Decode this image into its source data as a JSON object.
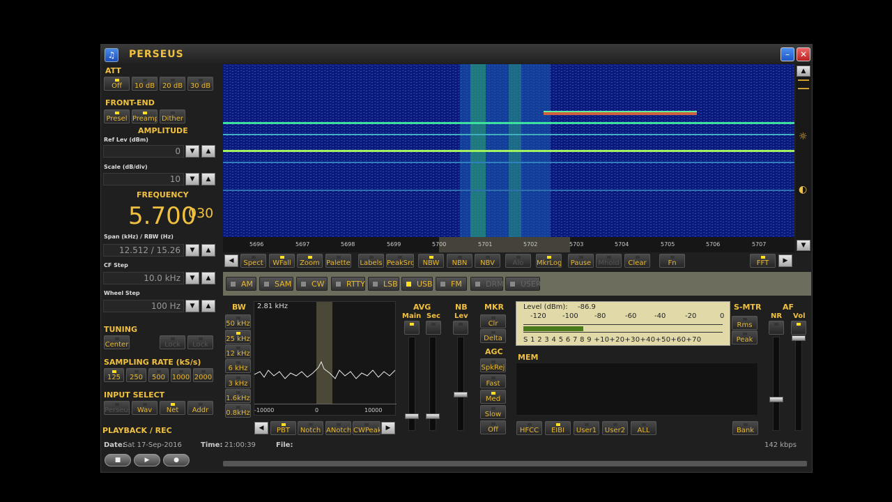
{
  "window": {
    "title": "PERSEUS",
    "min_icon": "minimize-icon",
    "close_icon": "close-icon"
  },
  "att": {
    "label": "ATT",
    "buttons": [
      {
        "label": "Off",
        "on": true
      },
      {
        "label": "10 dB",
        "on": false
      },
      {
        "label": "20 dB",
        "on": false
      },
      {
        "label": "30 dB",
        "on": false
      }
    ]
  },
  "frontend": {
    "label": "FRONT-END",
    "buttons": [
      {
        "label": "Presel",
        "on": true
      },
      {
        "label": "Preamp",
        "on": true
      },
      {
        "label": "Dither",
        "on": false
      }
    ]
  },
  "amplitude": {
    "label": "AMPLITUDE",
    "ref_label": "Ref Lev (dBm)",
    "ref_value": "0",
    "scale_label": "Scale (dB/div)",
    "scale_value": "10"
  },
  "frequency": {
    "label": "FREQUENCY",
    "main": "5.700",
    "fine": "030",
    "span_label": "Span (kHz) / RBW (Hz)",
    "span_value": "12.512 / 15.26",
    "cf_label": "CF Step",
    "cf_value": "10.0 kHz",
    "wheel_label": "Wheel Step",
    "wheel_value": "100 Hz"
  },
  "tuning": {
    "label": "TUNING",
    "center": "Center",
    "b2": "Lock",
    "b3": "Lock"
  },
  "sampling": {
    "label": "SAMPLING RATE (kS/s)",
    "rates": [
      "125",
      "250",
      "500",
      "1000",
      "2000"
    ]
  },
  "input": {
    "label": "INPUT SELECT",
    "buttons": [
      "Perseus",
      "Wav",
      "Net",
      "Addr"
    ]
  },
  "playback": {
    "label": "PLAYBACK / REC"
  },
  "status": {
    "date_label": "Date:",
    "date": "Sat 17-Sep-2016",
    "time_label": "Time:",
    "time": "21:00:39",
    "file_label": "File:",
    "rate": "142 kbps"
  },
  "spectrum": {
    "ticks": [
      "5696",
      "5697",
      "5698",
      "5699",
      "5700",
      "5701",
      "5702",
      "5703",
      "5704",
      "5705",
      "5706",
      "5707"
    ]
  },
  "toolbar": {
    "buttons": [
      "Spect",
      "WFall",
      "Zoom",
      "Palette",
      "Labels",
      "PeakSrc",
      "NBW",
      "NBN",
      "NBV",
      "Alo",
      "MkrLog",
      "Pause",
      "Mhold",
      "Clear",
      "Fn",
      "FFT"
    ]
  },
  "modes": [
    {
      "label": "AM",
      "on": false
    },
    {
      "label": "SAM",
      "on": false
    },
    {
      "label": "CW",
      "on": false
    },
    {
      "label": "RTTY",
      "on": false
    },
    {
      "label": "LSB",
      "on": false
    },
    {
      "label": "USB",
      "on": true
    },
    {
      "label": "FM",
      "on": false
    },
    {
      "label": "DRM",
      "on": false
    },
    {
      "label": "USER",
      "on": false
    }
  ],
  "bw": {
    "label": "BW",
    "value": "2.81 kHz",
    "buttons": [
      "50 kHz",
      "25 kHz",
      "12 kHz",
      "6 kHz",
      "3 kHz",
      "1.6kHz",
      "0.8kHz"
    ],
    "axis": [
      "-10000",
      "0",
      "10000"
    ],
    "bottom": [
      "PBT",
      "Notch",
      "ANotch",
      "CWPeak"
    ]
  },
  "avg": {
    "label": "AVG",
    "main": "Main",
    "sec": "Sec"
  },
  "nb": {
    "label": "NB",
    "lev": "Lev"
  },
  "mkr": {
    "label": "MKR",
    "clr": "Clr",
    "delta": "Delta"
  },
  "agc": {
    "label": "AGC",
    "buttons": [
      "SpkRej",
      "Fast",
      "Med",
      "Slow",
      "Off"
    ]
  },
  "smeter": {
    "level_label": "Level (dBm):",
    "level": "-86.9",
    "top_scale": [
      "-120",
      "-100",
      "-80",
      "-60",
      "-40",
      "-20",
      "0"
    ],
    "bottom_scale": "S 1 2 3 4 5 6 7 8 9 +10+20+30+40+50+60+70",
    "level_fraction": 0.3
  },
  "smtr": {
    "label": "S-MTR",
    "rms": "Rms",
    "peak": "Peak"
  },
  "af": {
    "label": "AF",
    "nr": "NR",
    "vol": "Vol"
  },
  "mem": {
    "label": "MEM",
    "buttons": [
      "HFCC",
      "EIBI",
      "User1",
      "User2",
      "ALL",
      "Bank"
    ]
  },
  "playback_buttons": [
    "stop-icon",
    "play-icon",
    "record-icon"
  ]
}
